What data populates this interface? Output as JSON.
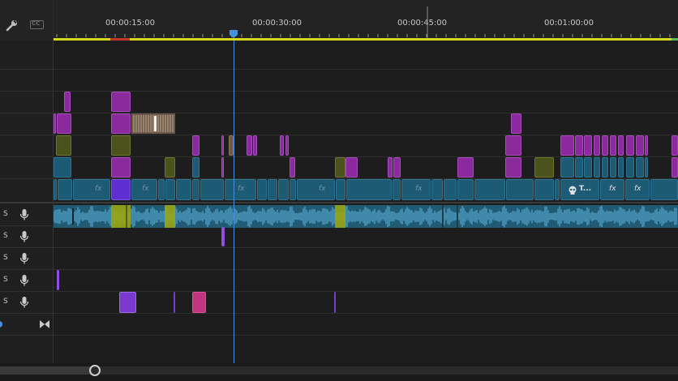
{
  "timecodes": [
    {
      "label": "00:00:15:00"
    },
    {
      "label": "00:00:30:00"
    },
    {
      "label": "00:00:45:00"
    },
    {
      "label": "00:01:00:00"
    }
  ],
  "playhead_time_seconds": 27.8,
  "header": {
    "wrench_icon": "wrench-icon",
    "cc_label": "CC"
  },
  "audio_tracks": [
    {
      "solo": "S"
    },
    {
      "solo": "S"
    },
    {
      "solo": "S"
    },
    {
      "solo": "S"
    },
    {
      "solo": "S"
    }
  ],
  "clip_labels": {
    "fx": "fx",
    "title_clip": "T..."
  },
  "colors": {
    "timeline_bar": "#d6d61e",
    "playhead": "#4a90e2",
    "video_magenta": "#8a2a9c",
    "video_olive": "#4b521c",
    "video_teal": "#1d5a74",
    "audio_blue": "#5fb8e0",
    "audio_lime": "#b4c214",
    "audio_pink": "#e0509a",
    "audio_purple": "#8f4fe0"
  }
}
